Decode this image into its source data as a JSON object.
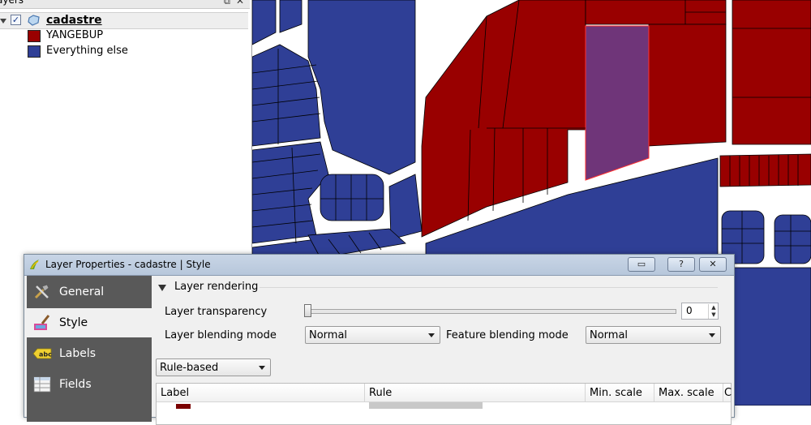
{
  "layers_panel": {
    "title": "ayers",
    "layer": {
      "name": "cadastre",
      "checked": true,
      "check_glyph": "✓"
    },
    "legend": [
      {
        "label": "YANGEBUP",
        "color": "#990000"
      },
      {
        "label": "Everything else",
        "color": "#2f3f96"
      }
    ]
  },
  "map": {
    "colors": {
      "red": "#990000",
      "blue": "#2f3f96",
      "selected": "#6f3579",
      "road": "#ffffff",
      "outline": "#000000"
    }
  },
  "dialog": {
    "title": "Layer Properties - cadastre | Style",
    "titlebar_buttons": {
      "restore": "▭",
      "help": "?",
      "close": "✕"
    },
    "sidebar": [
      {
        "label": "General",
        "icon": "tools-icon"
      },
      {
        "label": "Style",
        "icon": "paintbrush-icon",
        "selected": true
      },
      {
        "label": "Labels",
        "icon": "abc-label-icon"
      },
      {
        "label": "Fields",
        "icon": "table-icon"
      }
    ],
    "layer_rendering": {
      "title": "Layer rendering",
      "transparency_label": "Layer transparency",
      "transparency_value": "0",
      "transparency_level": 0,
      "blending_label": "Layer blending mode",
      "blending_value": "Normal",
      "feature_blending_label": "Feature blending mode",
      "feature_blending_value": "Normal"
    },
    "renderer_value": "Rule-based",
    "table_columns": [
      "Label",
      "Rule",
      "Min. scale",
      "Max. scale",
      "C"
    ]
  }
}
